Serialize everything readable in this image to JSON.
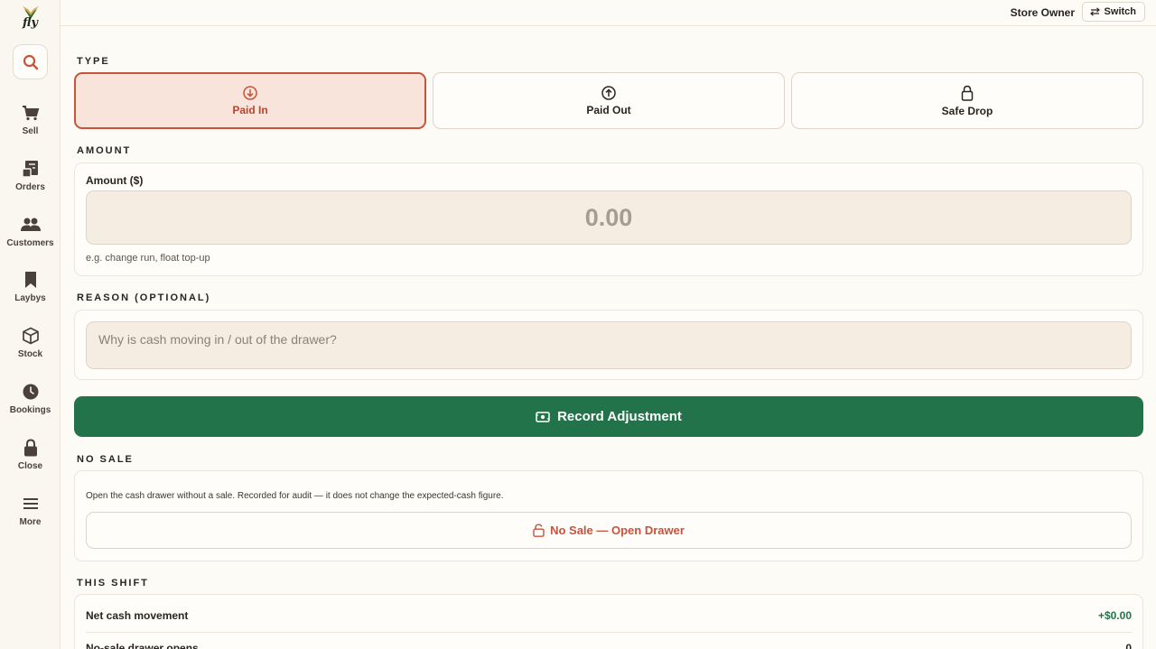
{
  "app": {
    "logo_text": "fly"
  },
  "sidebar": {
    "items": [
      {
        "label": "Sell",
        "icon": "cart-icon"
      },
      {
        "label": "Orders",
        "icon": "receipt-icon"
      },
      {
        "label": "Customers",
        "icon": "people-icon"
      },
      {
        "label": "Laybys",
        "icon": "bookmark-icon"
      },
      {
        "label": "Stock",
        "icon": "box-icon"
      },
      {
        "label": "Bookings",
        "icon": "clock-icon"
      },
      {
        "label": "Close",
        "icon": "lock-icon"
      },
      {
        "label": "More",
        "icon": "menu-icon"
      }
    ]
  },
  "header": {
    "role": "Store Owner",
    "switch_label": "Switch"
  },
  "type": {
    "section_label": "TYPE",
    "options": [
      {
        "label": "Paid In",
        "icon": "arrow-down-circle-icon",
        "selected": true
      },
      {
        "label": "Paid Out",
        "icon": "arrow-up-circle-icon",
        "selected": false
      },
      {
        "label": "Safe Drop",
        "icon": "lock-icon",
        "selected": false
      }
    ]
  },
  "amount": {
    "section_label": "AMOUNT",
    "field_label": "Amount ($)",
    "placeholder": "0.00",
    "hint": "e.g. change run, float top-up"
  },
  "reason": {
    "section_label": "REASON (OPTIONAL)",
    "placeholder": "Why is cash moving in / out of the drawer?"
  },
  "record_button": {
    "label": "Record Adjustment",
    "icon": "cash-icon"
  },
  "no_sale": {
    "section_label": "NO SALE",
    "description": "Open the cash drawer without a sale. Recorded for audit — it does not change the expected-cash figure.",
    "button_label": "No Sale — Open Drawer",
    "icon": "unlock-icon"
  },
  "shift": {
    "section_label": "THIS SHIFT",
    "rows": [
      {
        "label": "Net cash movement",
        "value": "+$0.00"
      },
      {
        "label": "No-sale drawer opens",
        "value": "0"
      }
    ]
  },
  "colors": {
    "accent": "#c8533b",
    "primary_green": "#23734a",
    "background": "#fdfbf6"
  }
}
